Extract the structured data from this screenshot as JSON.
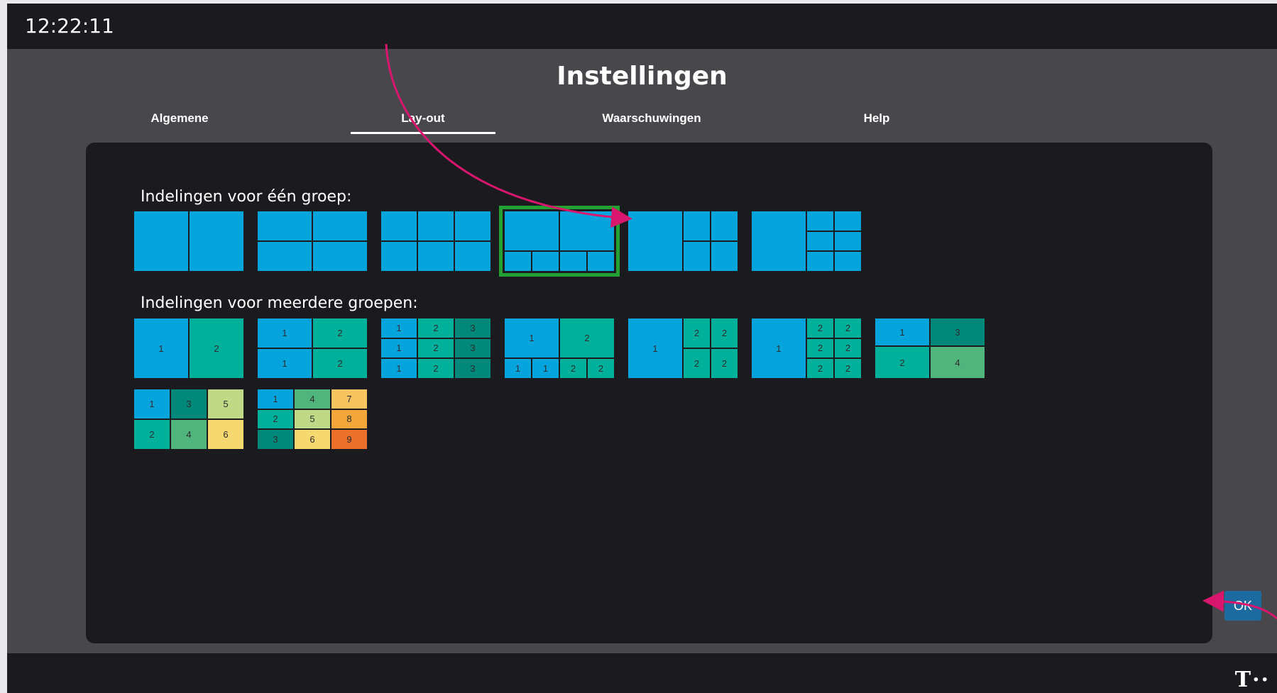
{
  "topbar": {
    "clock": "12:22:11"
  },
  "page": {
    "title": "Instellingen"
  },
  "tabs": [
    {
      "label": "Algemene",
      "active": false
    },
    {
      "label": "Lay-out",
      "active": true
    },
    {
      "label": "Waarschuwingen",
      "active": false
    },
    {
      "label": "Help",
      "active": false
    }
  ],
  "panel": {
    "single_group_label": "Indelingen voor één groep:",
    "multi_group_label": "Indelingen voor meerdere groepen:",
    "selected_single_layout": 4,
    "ok_label": "OK"
  },
  "colors": {
    "background": "#48484c",
    "bar": "#1b1b1f",
    "panel": "#1b1b1f",
    "tile_blue": "#06a4dd",
    "selected_border": "#23a133",
    "ok_button": "#1c6aa0",
    "annotation_arrow": "#d9166d",
    "group_1": "#06a4dd",
    "group_2": "#00b09b",
    "group_3": "#00897b",
    "group_4": "#50b47d",
    "group_5": "#bfd987",
    "group_6": "#f6d871",
    "group_7": "#f6c560",
    "group_8": "#f3a73b",
    "group_9": "#ec6f2a"
  },
  "icons": {
    "brand_logo": "telekom-logo-icon"
  }
}
